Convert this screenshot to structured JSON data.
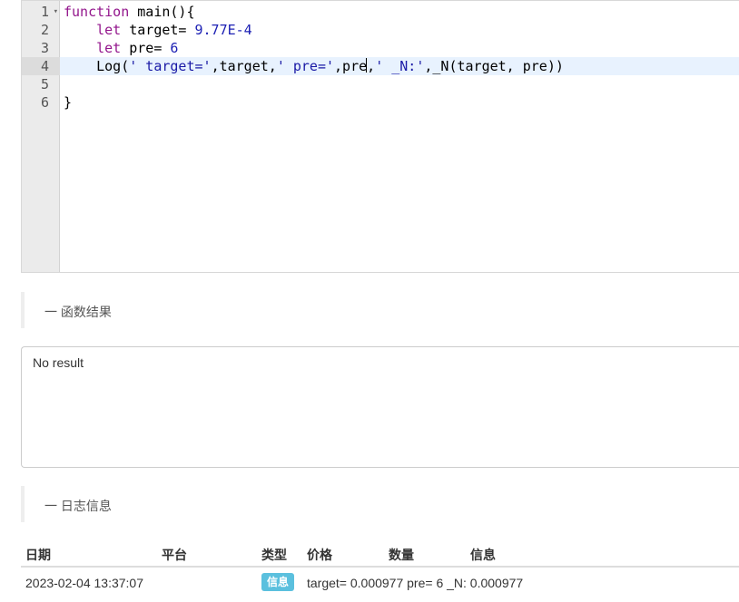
{
  "editor": {
    "line_numbers": [
      "1",
      "2",
      "3",
      "4",
      "5",
      "6"
    ],
    "line1": {
      "kw": "function",
      "rest": " main(){"
    },
    "line2": {
      "indent": "    ",
      "kw": "let",
      "mid": " target= ",
      "num": "9.77E-4"
    },
    "line3": {
      "indent": "    ",
      "kw": "let",
      "mid": " pre= ",
      "num": "6"
    },
    "line4": {
      "p1": "    Log(",
      "s1": "' target='",
      "p2": ",target,",
      "s2": "' pre='",
      "p3": ",pre",
      "p4": ",",
      "s3": "' _N:'",
      "p5": ",_N(target, pre))"
    },
    "line6": "}"
  },
  "sections": {
    "result_title": "一 函数结果",
    "log_title": "一 日志信息"
  },
  "result": {
    "text": "No result"
  },
  "log": {
    "headers": {
      "date": "日期",
      "platform": "平台",
      "type": "类型",
      "price": "价格",
      "amount": "数量",
      "info": "信息"
    },
    "rows": [
      {
        "date": "2023-02-04 13:37:07",
        "platform": "",
        "type": "信息",
        "info": "target= 0.000977 pre= 6 _N: 0.000977"
      }
    ]
  },
  "colors": {
    "keyword": "#93168c",
    "number": "#1d21b4",
    "string": "#1a1aa6",
    "active_line": "#e8f2fe",
    "badge": "#5bc0de"
  }
}
